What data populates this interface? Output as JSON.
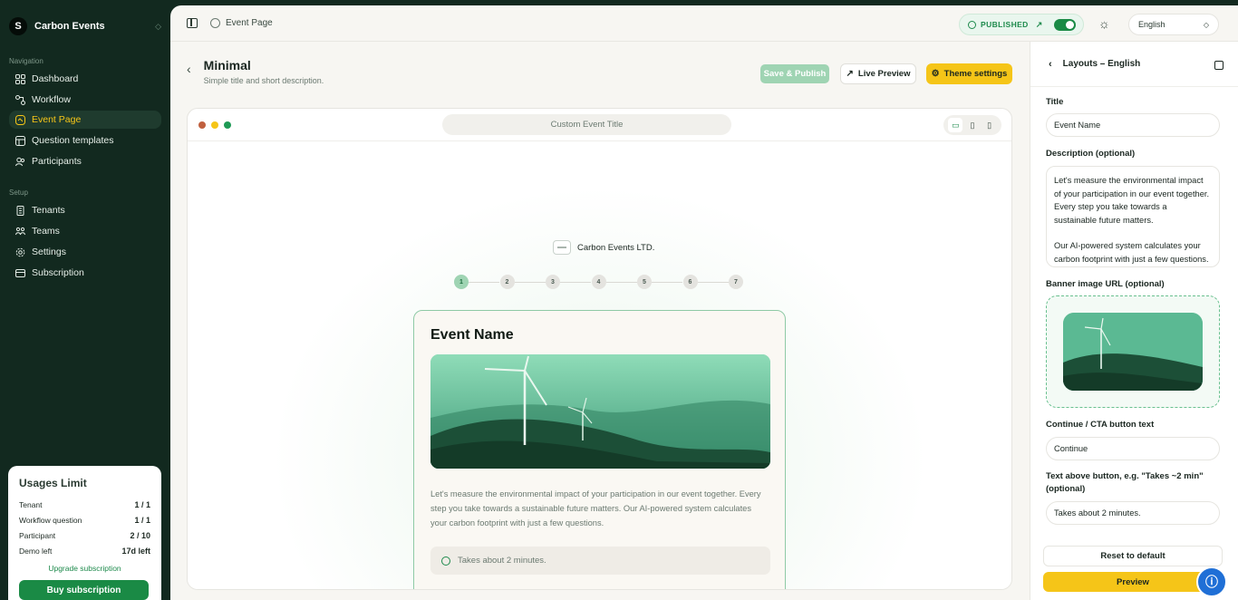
{
  "brand": {
    "initial": "S",
    "name": "Carbon Events"
  },
  "nav": {
    "section_navigation": "Navigation",
    "section_setup": "Setup",
    "items": [
      {
        "label": "Dashboard",
        "icon": "grid-icon"
      },
      {
        "label": "Workflow",
        "icon": "workflow-icon"
      },
      {
        "label": "Event Page",
        "icon": "page-icon",
        "active": true
      },
      {
        "label": "Question templates",
        "icon": "template-icon"
      },
      {
        "label": "Participants",
        "icon": "users-icon"
      }
    ],
    "setup_items": [
      {
        "label": "Tenants",
        "icon": "building-icon"
      },
      {
        "label": "Teams",
        "icon": "team-icon"
      },
      {
        "label": "Settings",
        "icon": "gear-icon"
      },
      {
        "label": "Subscription",
        "icon": "card-icon"
      }
    ]
  },
  "usage": {
    "title": "Usages Limit",
    "rows": [
      {
        "label": "Tenant",
        "value": "1 / 1"
      },
      {
        "label": "Workflow question",
        "value": "1 / 1"
      },
      {
        "label": "Participant",
        "value": "2 / 10"
      },
      {
        "label": "Demo left",
        "value": "17d left"
      }
    ],
    "upgrade_label": "Upgrade subscription",
    "buy_label": "Buy subscription"
  },
  "topbar": {
    "breadcrumb": "Event Page",
    "status": "PUBLISHED",
    "published": true,
    "language": "English"
  },
  "page": {
    "title": "Minimal",
    "subtitle": "Simple title and short description.",
    "save_label": "Save & Publish",
    "live_label": "Live Preview",
    "theme_label": "Theme settings"
  },
  "browser": {
    "url_text": "Custom Event Title",
    "dot_colors": [
      "#c0603f",
      "#f5c518",
      "#1e9a55"
    ]
  },
  "preview_page": {
    "company": "Carbon Events LTD.",
    "steps": [
      "1",
      "2",
      "3",
      "4",
      "5",
      "6",
      "7"
    ],
    "current_step": 1,
    "card_title": "Event Name",
    "description": "Let's measure the environmental impact of your participation in our event together. Every step you take towards a sustainable future matters. Our AI-powered system calculates your carbon footprint with just a few questions.",
    "takes": "Takes about 2 minutes."
  },
  "panel": {
    "header": "Layouts – English",
    "title_label": "Title",
    "title_value": "Event Name",
    "desc_label": "Description (optional)",
    "desc_p1": "Let's measure the environmental impact of your participation in our event together. Every step you take towards a sustainable future matters.",
    "desc_p2": "Our AI-powered system calculates your carbon footprint with just a few questions.",
    "banner_label": "Banner image URL (optional)",
    "cta_label": "Continue / CTA button text",
    "cta_value": "Continue",
    "above_label": "Text above button, e.g. \"Takes ~2 min\" (optional)",
    "above_value": "Takes about 2 minutes.",
    "reset_label": "Reset to default",
    "preview_label": "Preview"
  },
  "colors": {
    "sidebar_bg": "#12291f",
    "accent_yellow": "#f5c518",
    "accent_green": "#1a8a45",
    "help_blue": "#1f6fd6"
  }
}
